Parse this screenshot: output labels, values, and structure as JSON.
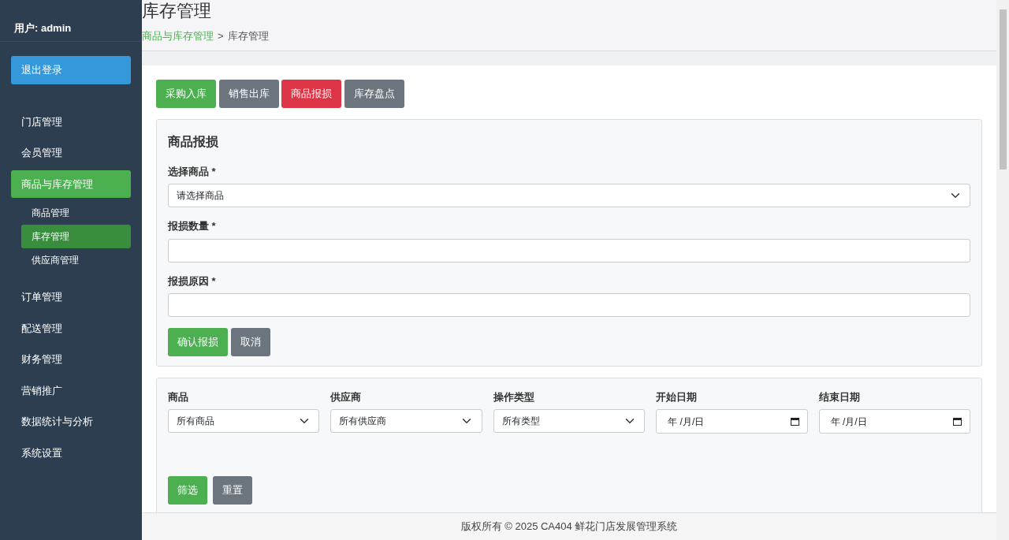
{
  "sidebar": {
    "user": "用户: admin",
    "logout": "退出登录",
    "items": [
      {
        "label": "门店管理",
        "selected": false
      },
      {
        "label": "会员管理",
        "selected": false
      },
      {
        "label": "商品与库存管理",
        "selected": true,
        "children": [
          {
            "label": "商品管理",
            "selected": false
          },
          {
            "label": "库存管理",
            "selected": true
          },
          {
            "label": "供应商管理",
            "selected": false
          }
        ]
      },
      {
        "label": "订单管理",
        "selected": false
      },
      {
        "label": "配送管理",
        "selected": false
      },
      {
        "label": "财务管理",
        "selected": false
      },
      {
        "label": "营销推广",
        "selected": false
      },
      {
        "label": "数据统计与分析",
        "selected": false
      },
      {
        "label": "系统设置",
        "selected": false
      }
    ]
  },
  "header": {
    "title": "库存管理",
    "breadcrumb": [
      {
        "label": "商品与库存管理",
        "kind": "link"
      },
      {
        "label": ">",
        "kind": "separator"
      },
      {
        "label": "库存管理",
        "kind": "current"
      }
    ]
  },
  "actions": [
    {
      "label": "采购入库",
      "color": "#4caf50"
    },
    {
      "label": "销售出库",
      "color": "#6c757d"
    },
    {
      "label": "商品报损",
      "color": "#dc3545"
    },
    {
      "label": "库存盘点",
      "color": "#6c757d"
    }
  ],
  "form": {
    "title": "商品报损",
    "fields": [
      {
        "label": "选择商品 *",
        "kind": "select",
        "value": "请选择商品"
      },
      {
        "label": "报损数量 *",
        "kind": "input"
      },
      {
        "label": "报损原因 *",
        "kind": "input"
      }
    ],
    "buttons": [
      {
        "label": "确认报损",
        "color": "#4caf50"
      },
      {
        "label": "取消",
        "color": "#6c757d"
      }
    ]
  },
  "filters": {
    "fields": [
      {
        "label": "商品",
        "kind": "select",
        "value": "所有商品"
      },
      {
        "label": "供应商",
        "kind": "select",
        "value": "所有供应商"
      },
      {
        "label": "操作类型",
        "kind": "select",
        "value": "所有类型"
      },
      {
        "label": "开始日期",
        "kind": "date",
        "value": "年 /月/日"
      },
      {
        "label": "结束日期",
        "kind": "date",
        "value": "年 /月/日"
      }
    ],
    "buttons": [
      {
        "label": "筛选",
        "color": "#4caf50"
      },
      {
        "label": "重置",
        "color": "#6c757d"
      }
    ]
  },
  "footer": "版权所有 © 2025 CA404 鲜花门店发展管理系统"
}
